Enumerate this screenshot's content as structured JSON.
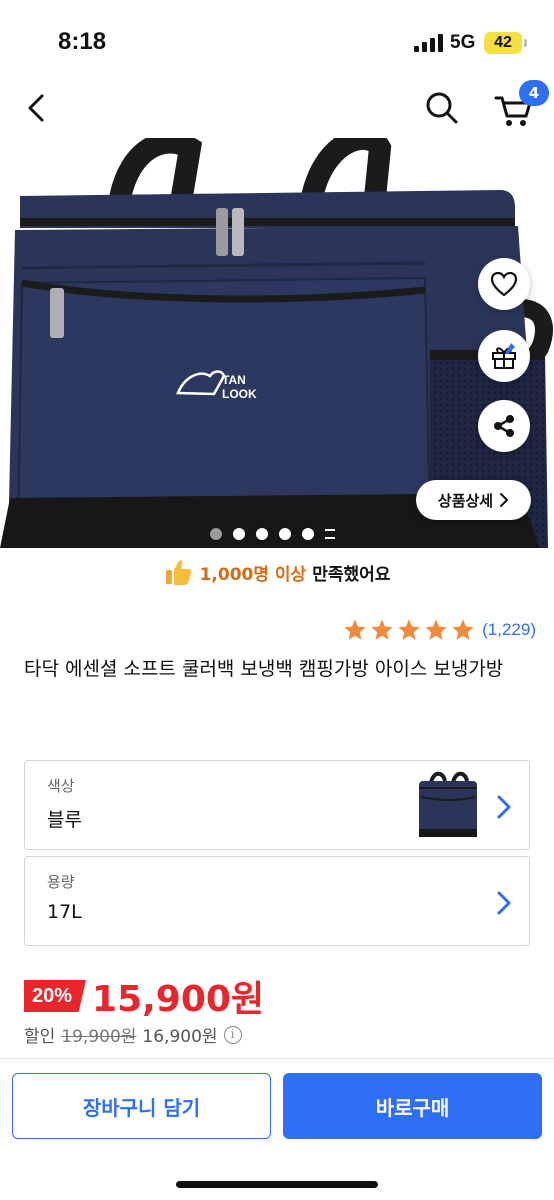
{
  "status": {
    "time": "8:18",
    "network": "5G",
    "battery": "42"
  },
  "nav": {
    "cart_count": "4",
    "icons": [
      "back-arrow-icon",
      "search-icon",
      "cart-icon"
    ]
  },
  "product_image": {
    "brand_logo": "TAN LOOK",
    "colors": {
      "bag": "#2b3559",
      "bag_dark": "#1f2745",
      "strap": "#1b1b1b"
    },
    "page_indicator": {
      "total_dots": 5,
      "active_index": 0
    }
  },
  "floating": {
    "detail_label": "상품상세",
    "icons": [
      "heart-icon",
      "gift-icon",
      "share-icon"
    ]
  },
  "satisfaction": {
    "highlight": "1,000명 이상",
    "rest": "만족했어요"
  },
  "rating": {
    "stars": 5,
    "count": "(1,229)",
    "star_color": "#f08a3c"
  },
  "product": {
    "title": "타닥 에센셜 소프트 쿨러백 보냉백 캠핑가방 아이스 보냉가방"
  },
  "options": [
    {
      "label": "색상",
      "value": "블루"
    },
    {
      "label": "용량",
      "value": "17L"
    }
  ],
  "price": {
    "discount": "20%",
    "final": "15,900원",
    "sub_label": "할인",
    "original": "19,900원",
    "member_price": "16,900원"
  },
  "actions": {
    "add_to_cart": "장바구니 담기",
    "buy_now": "바로구매"
  },
  "colors": {
    "accent": "#2f6ff5",
    "sale": "#e8262b",
    "highlight": "#d96a14"
  }
}
